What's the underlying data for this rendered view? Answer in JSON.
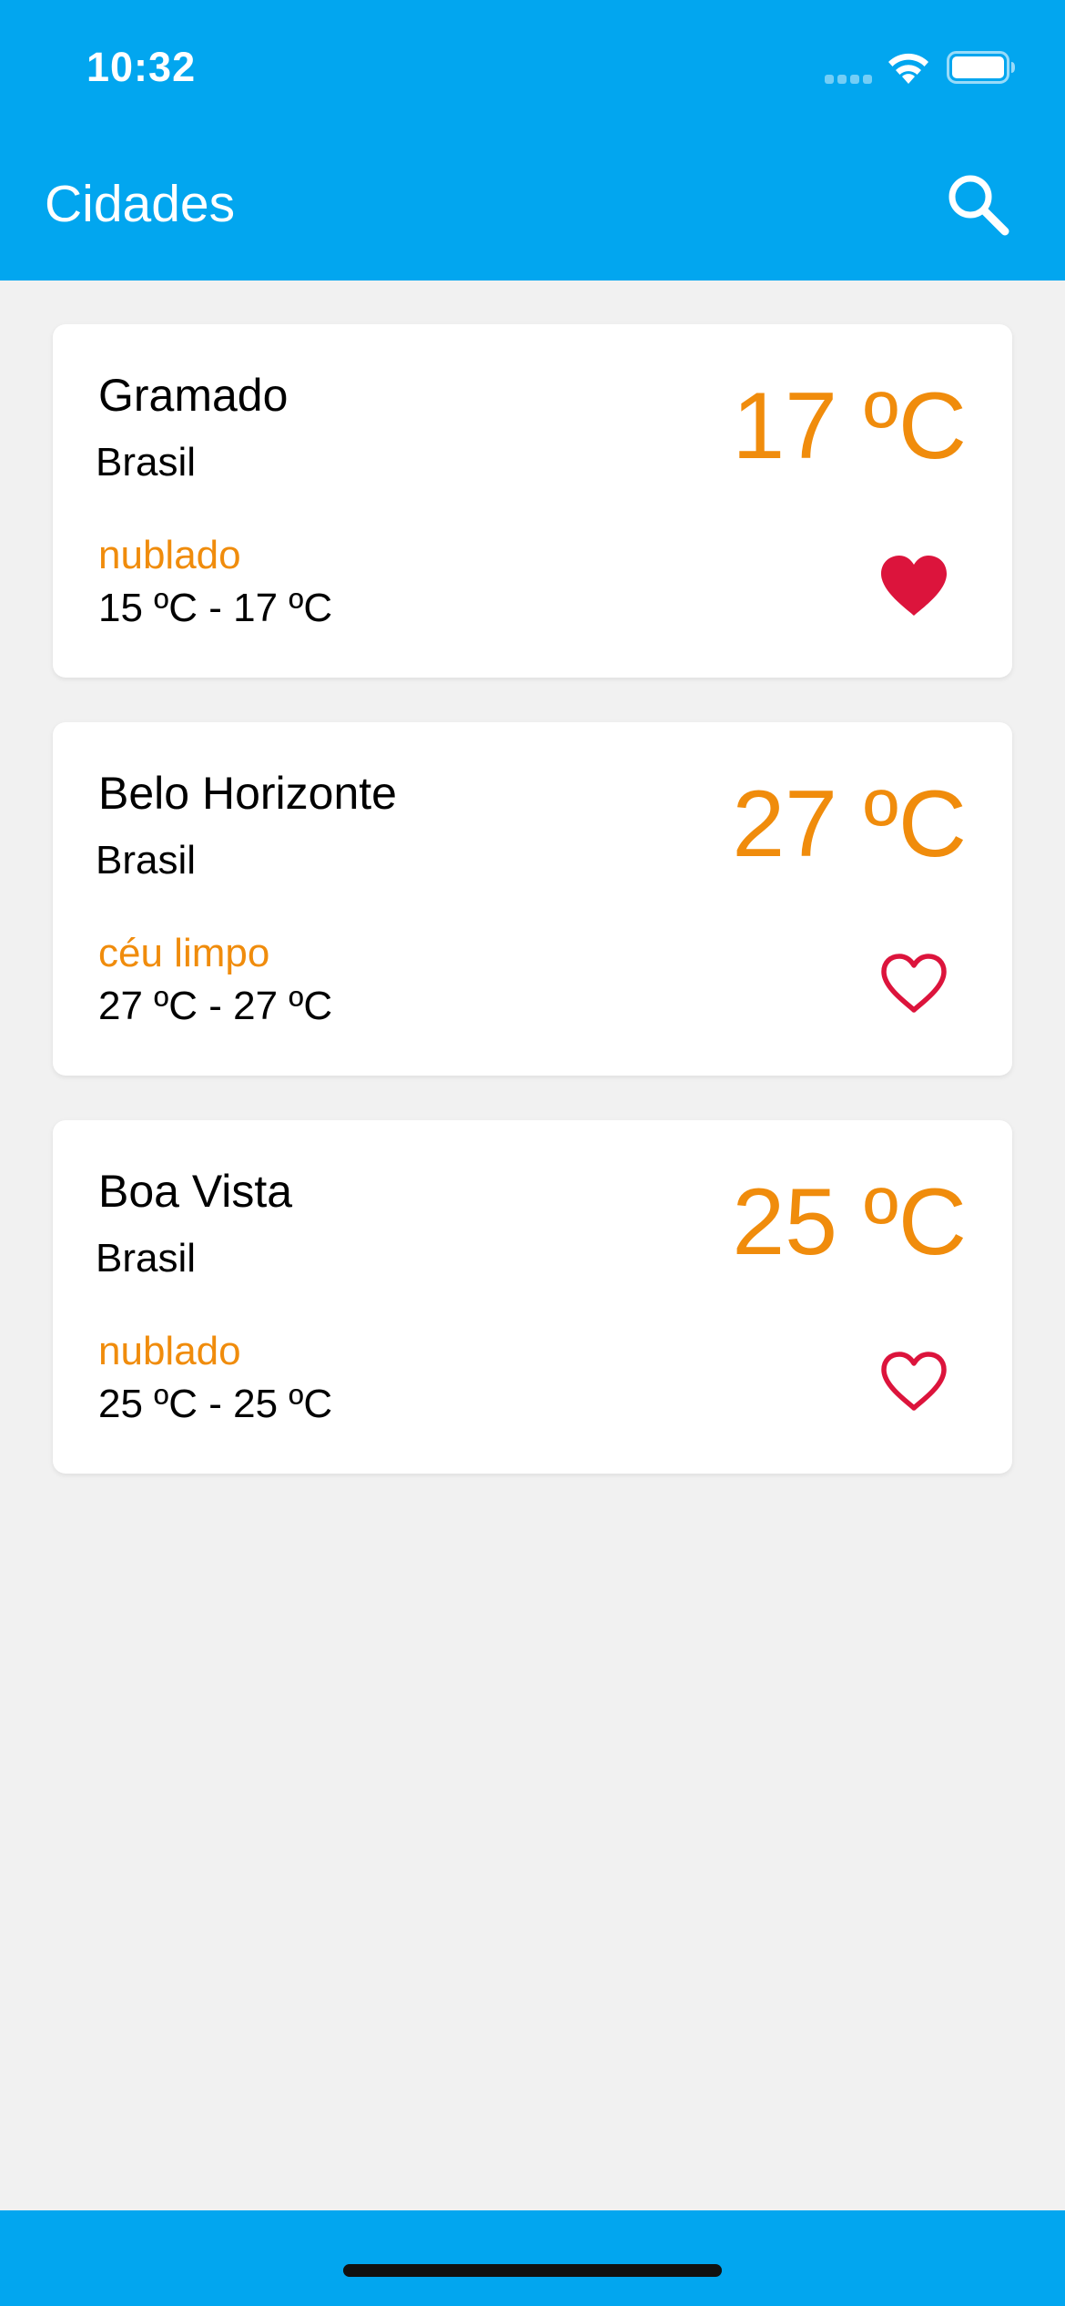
{
  "status_bar": {
    "time": "10:32",
    "icons": [
      "cellular-signal-icon",
      "wifi-icon",
      "battery-icon"
    ]
  },
  "nav": {
    "title": "Cidades",
    "search_icon": "search-icon"
  },
  "colors": {
    "primary": "#02a6ef",
    "accent": "#f08c0c",
    "favorite": "#dc143c",
    "background": "#f1f1f1"
  },
  "cities": [
    {
      "name": "Gramado",
      "country": "Brasil",
      "temp": "17 ºC",
      "description": "nublado",
      "range": "15 ºC - 17 ºC",
      "favorite": true
    },
    {
      "name": "Belo Horizonte",
      "country": "Brasil",
      "temp": "27 ºC",
      "description": "céu limpo",
      "range": "27 ºC - 27 ºC",
      "favorite": false
    },
    {
      "name": "Boa Vista",
      "country": "Brasil",
      "temp": "25 ºC",
      "description": "nublado",
      "range": "25 ºC - 25 ºC",
      "favorite": false
    }
  ]
}
